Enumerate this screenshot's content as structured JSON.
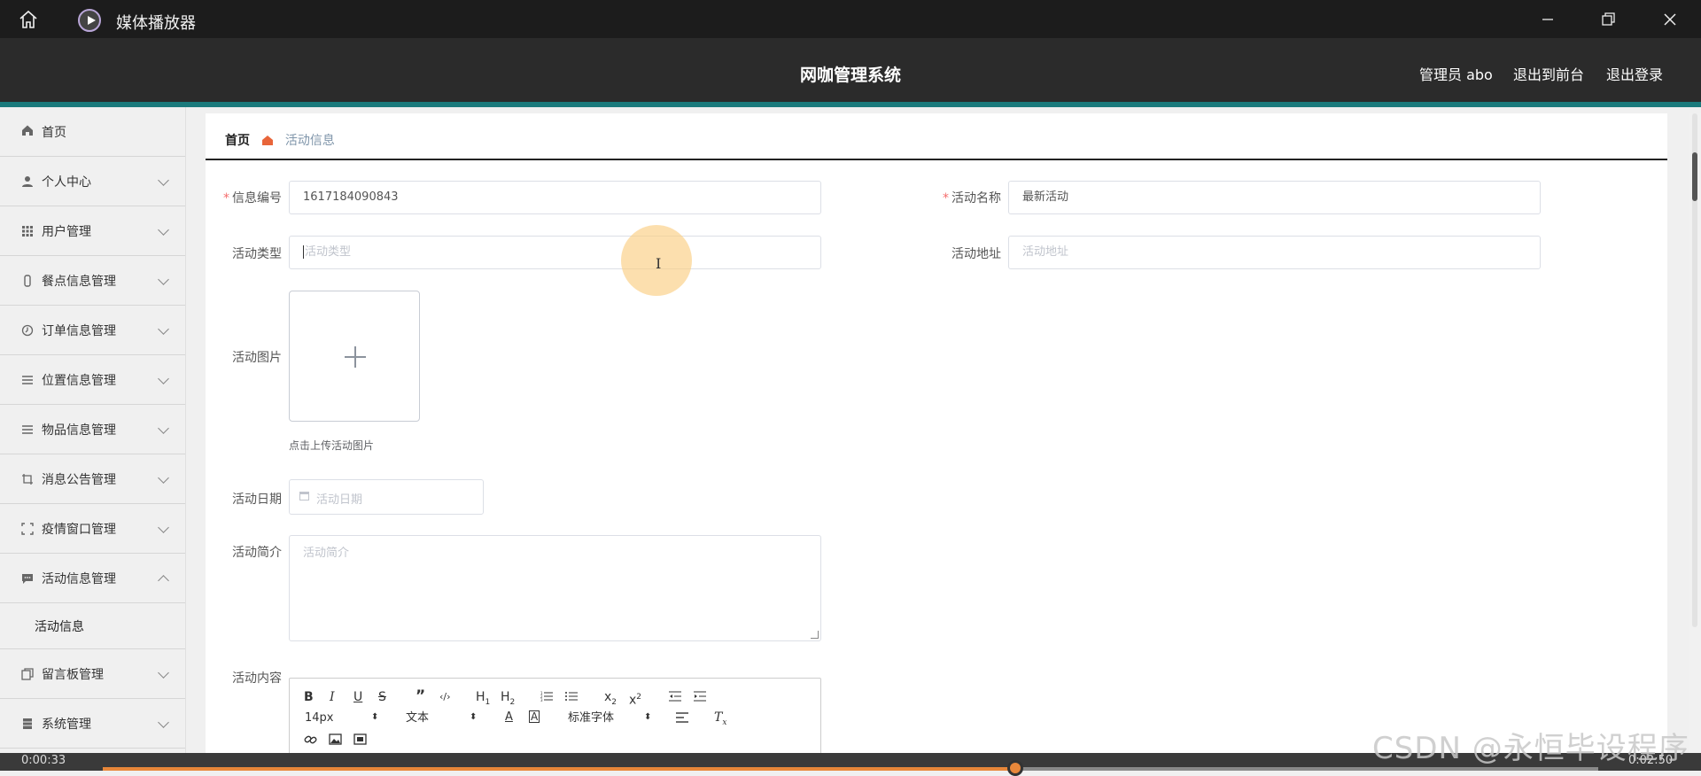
{
  "player": {
    "title": "媒体播放器",
    "time_elapsed": "0:00:33",
    "time_total": "0:02:50",
    "progress_fraction": 0.61
  },
  "header": {
    "title": "网咖管理系统",
    "user": "管理员 abo",
    "to_front": "退出到前台",
    "logout": "退出登录"
  },
  "sidebar": {
    "home": "首页",
    "items": [
      {
        "label": "个人中心",
        "icon": "user-icon"
      },
      {
        "label": "用户管理",
        "icon": "grid-icon"
      },
      {
        "label": "餐点信息管理",
        "icon": "bottle-icon"
      },
      {
        "label": "订单信息管理",
        "icon": "clock-icon"
      },
      {
        "label": "位置信息管理",
        "icon": "list-icon"
      },
      {
        "label": "物品信息管理",
        "icon": "list-icon"
      },
      {
        "label": "消息公告管理",
        "icon": "crop-icon"
      },
      {
        "label": "疫情窗口管理",
        "icon": "fullscreen-icon"
      },
      {
        "label": "活动信息管理",
        "icon": "message-icon"
      },
      {
        "label": "留言板管理",
        "icon": "copy-icon"
      },
      {
        "label": "系统管理",
        "icon": "cabinet-icon"
      }
    ],
    "active_sub": "活动信息"
  },
  "breadcrumb": {
    "home": "首页",
    "current": "活动信息"
  },
  "form": {
    "info_id": {
      "label": "信息编号",
      "value": "1617184090843"
    },
    "activity_name": {
      "label": "活动名称",
      "value": "最新活动"
    },
    "activity_type": {
      "label": "活动类型",
      "placeholder": "活动类型"
    },
    "activity_address": {
      "label": "活动地址",
      "placeholder": "活动地址"
    },
    "activity_image": {
      "label": "活动图片",
      "tip": "点击上传活动图片"
    },
    "activity_date": {
      "label": "活动日期",
      "placeholder": "活动日期"
    },
    "activity_intro": {
      "label": "活动简介",
      "placeholder": "活动简介"
    },
    "activity_content": {
      "label": "活动内容"
    }
  },
  "editor": {
    "font_size": "14px",
    "text_style": "文本",
    "font_family": "标准字体"
  },
  "watermark": "CSDN @永恒毕设程序"
}
